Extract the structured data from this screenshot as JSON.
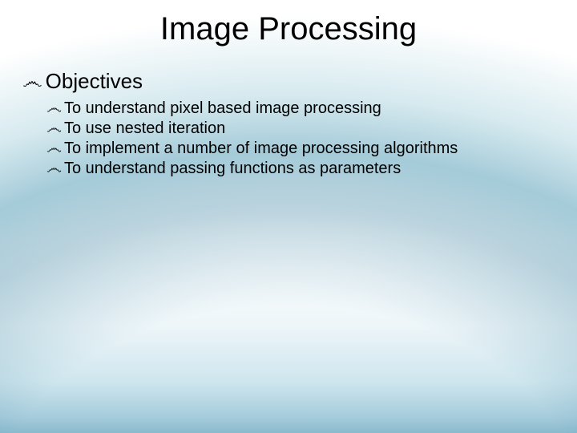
{
  "title": "Image Processing",
  "bullet_glyph": "෴",
  "section": {
    "heading": "Objectives",
    "items": [
      "To understand pixel based image processing",
      "To use nested iteration",
      "To implement a number of image processing algorithms",
      "To understand passing functions as parameters"
    ]
  }
}
